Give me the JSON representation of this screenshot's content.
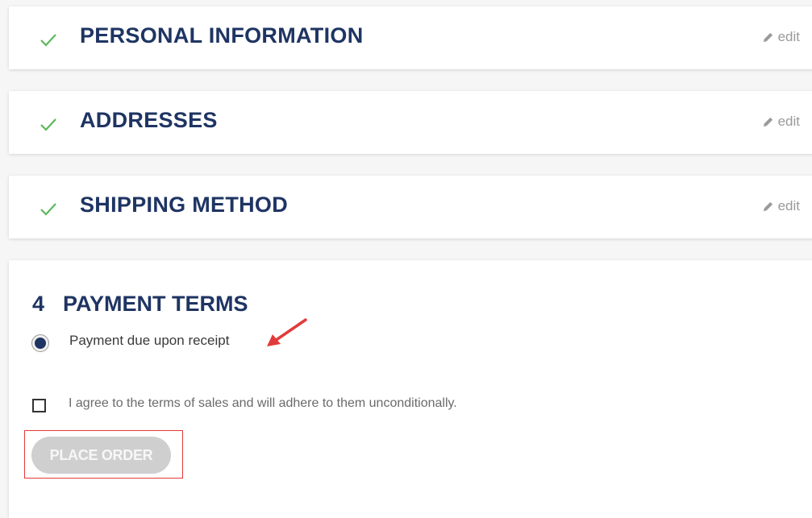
{
  "steps": [
    {
      "title": "PERSONAL INFORMATION",
      "edit_label": "edit"
    },
    {
      "title": "ADDRESSES",
      "edit_label": "edit"
    },
    {
      "title": "SHIPPING METHOD",
      "edit_label": "edit"
    }
  ],
  "payment": {
    "number": "4",
    "title": "PAYMENT TERMS",
    "option_label": "Payment due upon receipt",
    "option_selected": true,
    "terms_label": "I agree to the terms of sales and will adhere to them unconditionally.",
    "terms_checked": false,
    "place_order_label": "PLACE ORDER",
    "place_order_enabled": false
  },
  "colors": {
    "heading": "#1e3463",
    "check": "#5cb85c",
    "edit": "#9a9a9a",
    "annotation": "#e23a3a",
    "button_disabled": "#cfcfcf"
  },
  "icons": {
    "check": "check-icon",
    "edit": "pencil-icon",
    "annotation": "arrow-icon"
  }
}
